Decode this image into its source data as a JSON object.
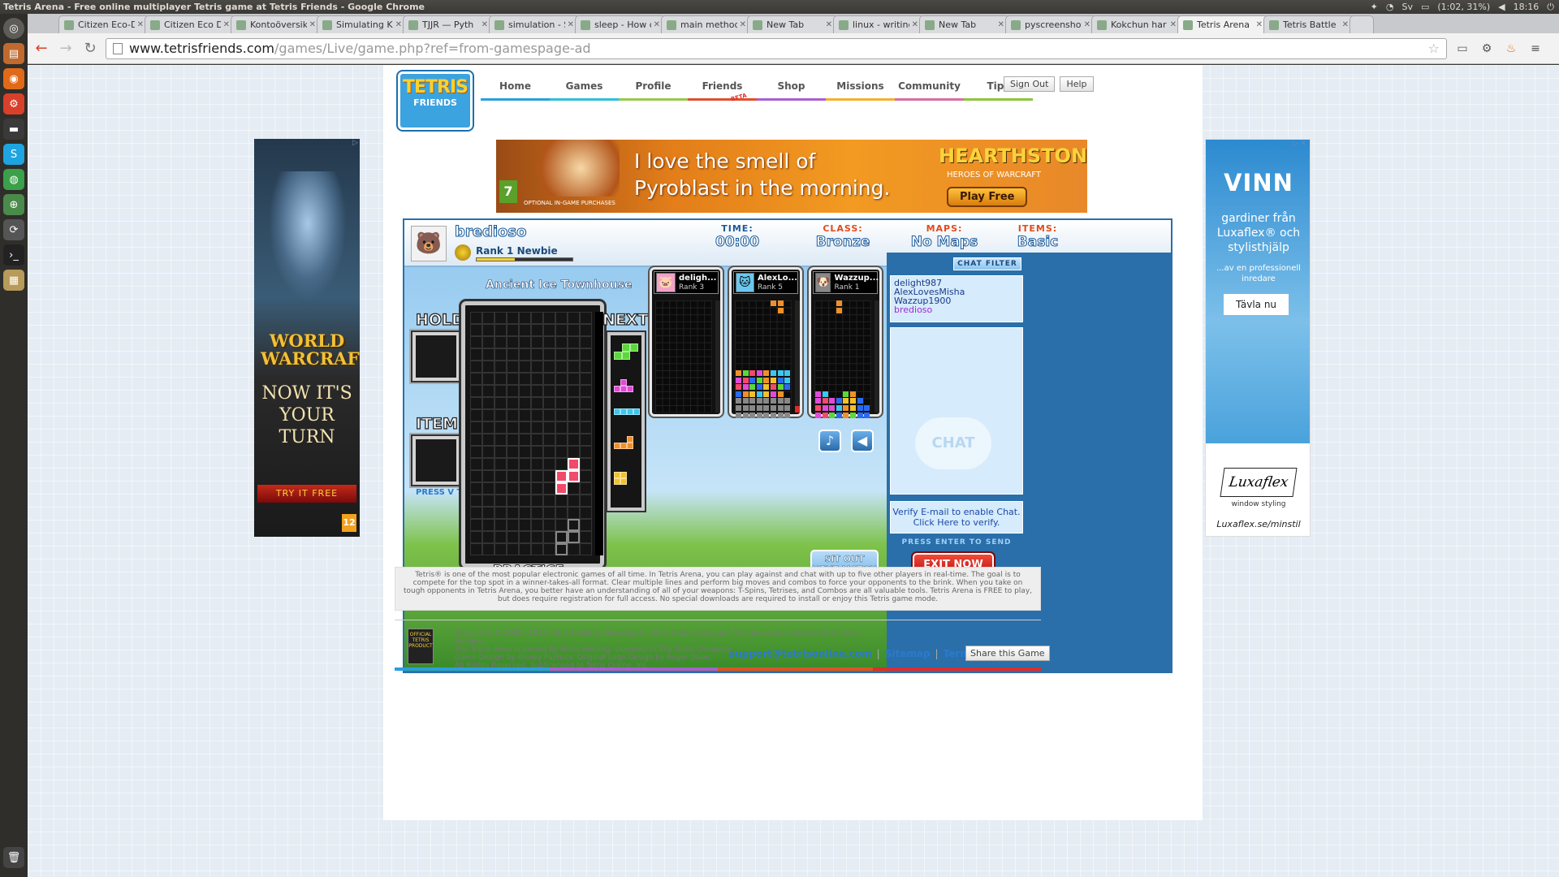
{
  "os": {
    "window_title": "Tetris Arena - Free online multiplayer Tetris game at Tetris Friends - Google Chrome",
    "tray_battery": "(1:02, 31%)",
    "tray_time": "18:16"
  },
  "launcher": [
    "home-icon",
    "files-icon",
    "firefox-icon",
    "ubuntu-software-icon",
    "terminal-icon",
    "skype-icon",
    "chrome-icon",
    "network-icon",
    "update-icon",
    "terminal2-icon",
    "folder-icon",
    "trash-icon"
  ],
  "tabs": [
    {
      "label": "Citizen Eco-D"
    },
    {
      "label": "Citizen Eco D"
    },
    {
      "label": "Kontoöversik"
    },
    {
      "label": "Simulating K"
    },
    {
      "label": "TJJR — Pyth"
    },
    {
      "label": "simulation - S"
    },
    {
      "label": "sleep - How c"
    },
    {
      "label": "main method"
    },
    {
      "label": "New Tab"
    },
    {
      "label": "linux - writing"
    },
    {
      "label": "New Tab"
    },
    {
      "label": "pyscreenshot"
    },
    {
      "label": "Kokchun har"
    },
    {
      "label": "Tetris Arena"
    },
    {
      "label": "Tetris Battle"
    }
  ],
  "active_tab": 13,
  "address": {
    "host": "www.tetrisfriends.com",
    "path": "/games/Live/game.php?ref=from-gamespage-ad"
  },
  "site": {
    "logo_top": "TETRIS",
    "logo_bottom": "FRIENDS",
    "nav": [
      "Home",
      "Games",
      "Profile",
      "Friends",
      "Shop",
      "Missions",
      "Community",
      "Tips"
    ],
    "beta": "BETA",
    "sign_out": "Sign Out",
    "help": "Help"
  },
  "banner": {
    "text": "I love the smell of Pyroblast in the morning.",
    "brand": "HEARTHSTONE",
    "brand_sub": "HEROES OF WARCRAFT",
    "cta": "Play Free",
    "age": "7",
    "fine": "OPTIONAL IN-GAME PURCHASES"
  },
  "game": {
    "player": "bredioso",
    "rank": "Rank 1 Newbie",
    "xp_fraction": 0.4,
    "time_label": "TIME:",
    "time": "00:00",
    "class_label": "CLASS:",
    "class": "Bronze",
    "maps_label": "MAPS:",
    "maps": "No Maps",
    "items_label": "ITEMS:",
    "items": "Basic",
    "map_name": "Ancient Ice Townhouse",
    "hold": "HOLD",
    "item": "ITEM",
    "press_v": "PRESS V TO USE",
    "next": "NEXT",
    "mode": "PRACTICE",
    "sit_out": "SIT OUT NEXT MATCH",
    "colors": {
      "z": "#f24a6a",
      "t": "#e24ad8",
      "s": "#5ad83a",
      "i": "#3ac8f0",
      "l": "#f0902a",
      "o": "#f2c12a",
      "j": "#2a6af0"
    },
    "opponents": [
      {
        "name": "deligh...",
        "rank": "Rank 3"
      },
      {
        "name": "AlexLo...",
        "rank": "Rank 5"
      },
      {
        "name": "Wazzup...",
        "rank": "Rank 1"
      }
    ],
    "chat": {
      "filter": "CHAT FILTER",
      "users": [
        "delight987",
        "AlexLovesMisha",
        "Wazzup1900",
        "bredioso"
      ],
      "bubble": "CHAT",
      "verify_1": "Verify E-mail to enable Chat.",
      "verify_2": "Click Here to verify.",
      "press_enter": "PRESS ENTER TO SEND",
      "exit": "EXIT NOW"
    }
  },
  "description": "Tetris® is one of the most popular electronic games of all time. In Tetris Arena, you can play against and chat with up to five other players in real-time. The goal is to compete for the top spot in a winner-takes-all format. Clear multiple lines and perform big moves and combos to force your opponents to the brink. When you take on tough opponents in Tetris Arena, you better have an understanding of all of your weapons: T-Spins, Tetrises, and Combos are all valuable tools. Tetris Arena is FREE to play, but does require registration for full access. No special downloads are required to install or enjoy this Tetris game mode.",
  "footer": {
    "logo": "OFFICIAL TETRIS PRODUCT",
    "legal": [
      "Tetris ® & © 1985~2015 Tetris Holding. Tetris logos, Tetris theme song and Tetriminos are trademarks of Tetris Holding.",
      "The Tetris dress is owned by Tetris Holding. Licensed to The Tetris Company.",
      "Game Design by Alexey Pajitnov. Original Logo Design by Roger Dean.",
      "All Rights Reserved. Sublicensed to Tetris Online, Inc."
    ],
    "email": "support@tetrisonline.com",
    "sitemap": "Sitemap",
    "terms": "Terms of Use",
    "share": "Share this Game"
  },
  "ad_left": {
    "logo": "WORLD WARCRAFT",
    "headline": "NOW IT'S YOUR TURN",
    "cta": "TRY IT FREE",
    "age": "12"
  },
  "ad_right": {
    "headline": "VINN",
    "text1": "gardiner från Luxaflex® och stylisthjälp",
    "text2": "...av en professionell inredare",
    "cta": "Tävla nu",
    "brand": "Luxaflex",
    "tagline": "window styling",
    "url": "Luxaflex.se/minstil"
  }
}
